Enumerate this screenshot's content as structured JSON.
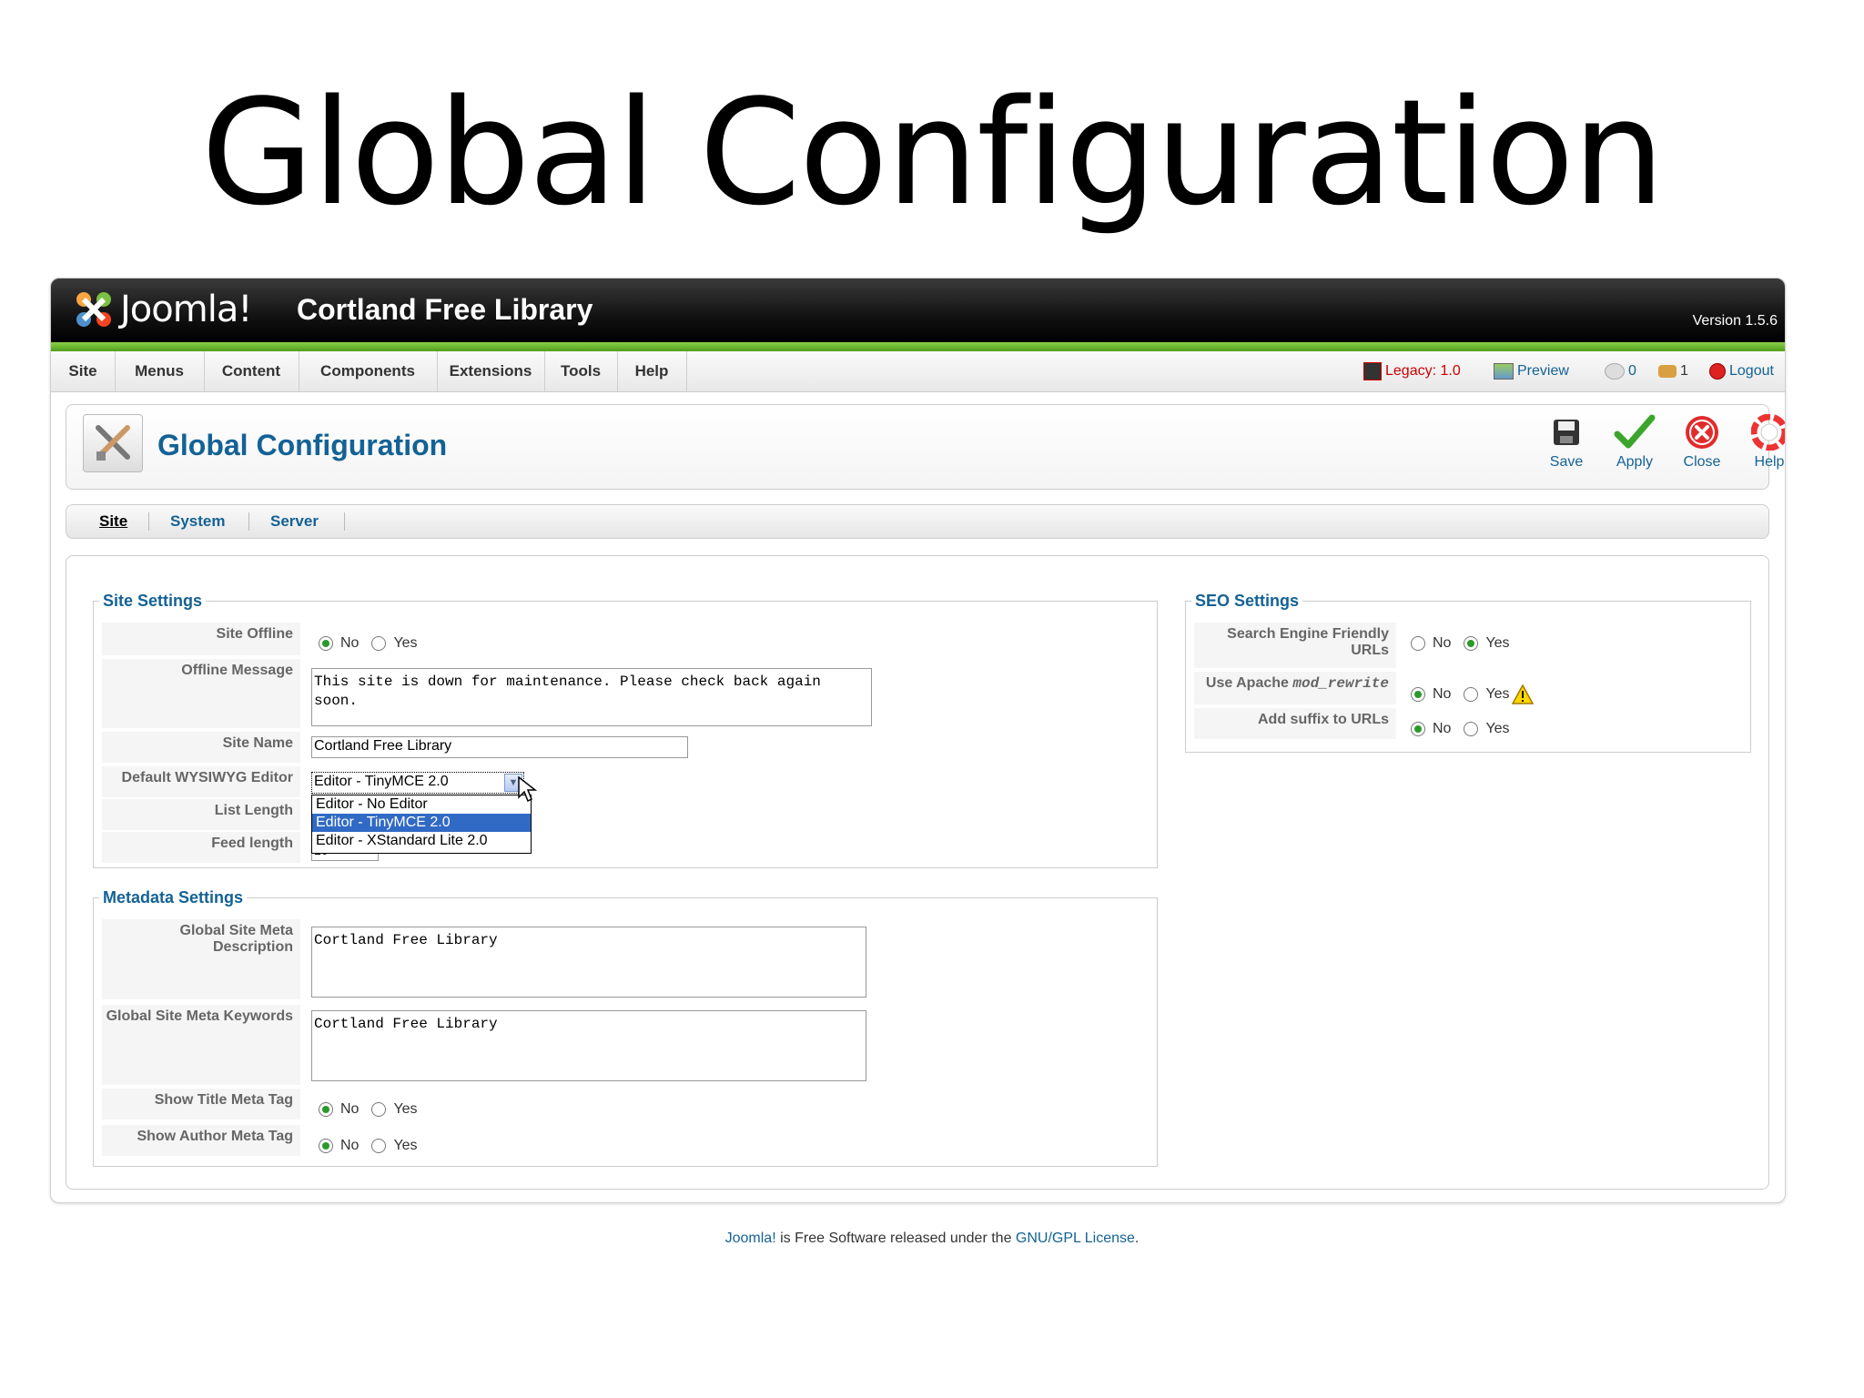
{
  "slide_title": "Global Configuration",
  "header": {
    "logo_text": "Joomla!",
    "site_name": "Cortland Free Library",
    "version": "Version 1.5.6"
  },
  "menubar": {
    "items": [
      "Site",
      "Menus",
      "Content",
      "Components",
      "Extensions",
      "Tools",
      "Help"
    ],
    "status": {
      "legacy": "Legacy: 1.0",
      "preview": "Preview",
      "messages": "0",
      "users": "1",
      "logout": "Logout"
    }
  },
  "toolbar": {
    "title": "Global Configuration",
    "buttons": {
      "save": "Save",
      "apply": "Apply",
      "close": "Close",
      "help": "Help"
    }
  },
  "tabs": [
    "Site",
    "System",
    "Server"
  ],
  "site_settings": {
    "legend": "Site Settings",
    "site_offline": {
      "label": "Site Offline",
      "no": "No",
      "yes": "Yes",
      "selected": "No"
    },
    "offline_message": {
      "label": "Offline Message",
      "value": "This site is down for maintenance. Please check back again soon."
    },
    "site_name": {
      "label": "Site Name",
      "value": "Cortland Free Library"
    },
    "editor": {
      "label": "Default WYSIWYG Editor",
      "value": "Editor - TinyMCE 2.0",
      "options": [
        "Editor - No Editor",
        "Editor - TinyMCE 2.0",
        "Editor - XStandard Lite 2.0"
      ],
      "highlighted": "Editor - TinyMCE 2.0"
    },
    "list_length": {
      "label": "List Length"
    },
    "feed_length": {
      "label": "Feed length",
      "value": "10"
    }
  },
  "metadata_settings": {
    "legend": "Metadata Settings",
    "description": {
      "label": "Global Site Meta Description",
      "value": "Cortland Free Library"
    },
    "keywords": {
      "label": "Global Site Meta Keywords",
      "value": "Cortland Free Library"
    },
    "show_title": {
      "label": "Show Title Meta Tag",
      "no": "No",
      "yes": "Yes",
      "selected": "No"
    },
    "show_author": {
      "label": "Show Author Meta Tag",
      "no": "No",
      "yes": "Yes",
      "selected": "No"
    }
  },
  "seo_settings": {
    "legend": "SEO Settings",
    "sef_urls": {
      "label": "Search Engine Friendly URLs",
      "no": "No",
      "yes": "Yes",
      "selected": "Yes"
    },
    "mod_rewrite": {
      "label_prefix": "Use Apache ",
      "label_code": "mod_rewrite",
      "no": "No",
      "yes": "Yes",
      "selected": "No"
    },
    "suffix": {
      "label": "Add suffix to URLs",
      "no": "No",
      "yes": "Yes",
      "selected": "No"
    }
  },
  "footer": {
    "link1": "Joomla!",
    "text": " is Free Software released under the ",
    "link2": "GNU/GPL License",
    "end": "."
  },
  "colors": {
    "accent": "#146295",
    "header_bg": "#121212",
    "green_stripe": "#6cbf2e",
    "dropdown_highlight": "#316ac5"
  }
}
